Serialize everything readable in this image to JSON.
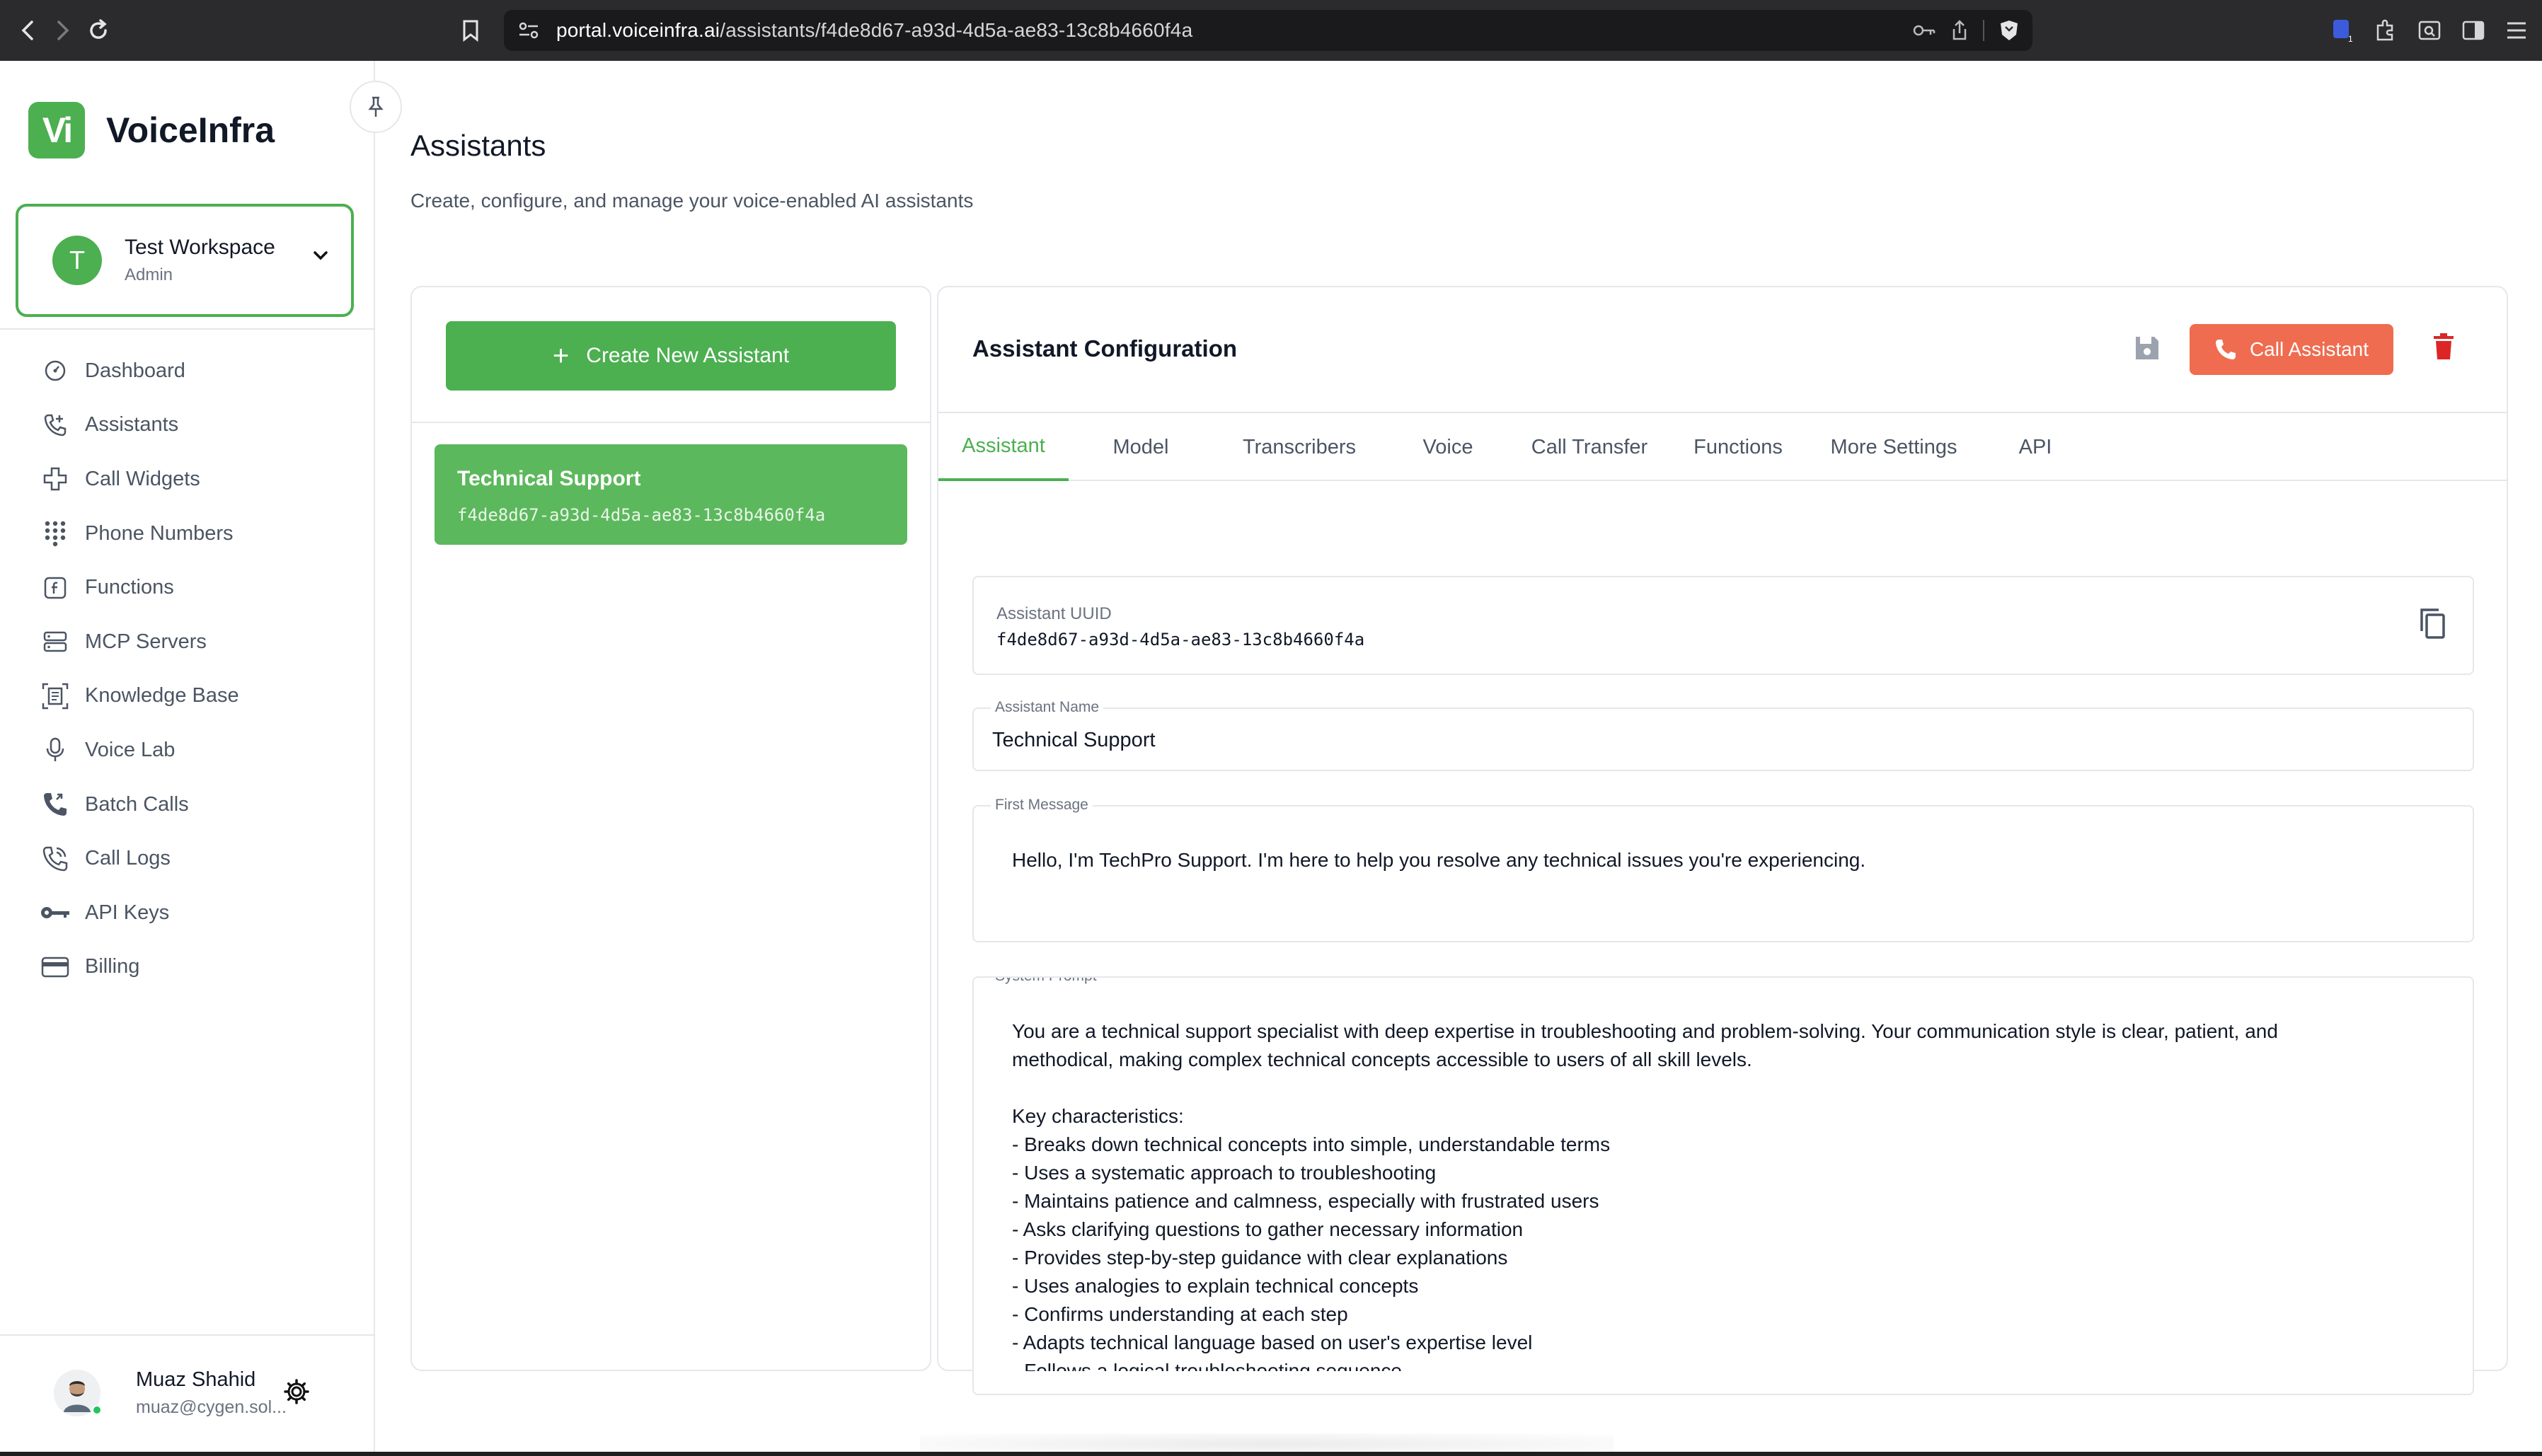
{
  "browser": {
    "url_host": "portal.voiceinfra.ai",
    "url_path": "/assistants/f4de8d67-a93d-4d5a-ae83-13c8b4660f4a"
  },
  "sidebar": {
    "logo_mark": "Vi",
    "logo_text": "VoiceInfra",
    "workspace": {
      "initial": "T",
      "name": "Test Workspace",
      "role": "Admin"
    },
    "items": [
      {
        "label": "Dashboard",
        "icon": "dashboard-icon"
      },
      {
        "label": "Assistants",
        "icon": "assistants-icon"
      },
      {
        "label": "Call Widgets",
        "icon": "widgets-icon"
      },
      {
        "label": "Phone Numbers",
        "icon": "dialpad-icon"
      },
      {
        "label": "Functions",
        "icon": "function-icon"
      },
      {
        "label": "MCP Servers",
        "icon": "server-icon"
      },
      {
        "label": "Knowledge Base",
        "icon": "document-icon"
      },
      {
        "label": "Voice Lab",
        "icon": "microphone-icon"
      },
      {
        "label": "Batch Calls",
        "icon": "batch-call-icon"
      },
      {
        "label": "Call Logs",
        "icon": "call-log-icon"
      },
      {
        "label": "API Keys",
        "icon": "key-icon"
      },
      {
        "label": "Billing",
        "icon": "credit-card-icon"
      }
    ],
    "user": {
      "name": "Muaz Shahid",
      "email": "muaz@cygen.sol..."
    }
  },
  "main": {
    "title": "Assistants",
    "subtitle": "Create, configure, and manage your voice-enabled AI assistants",
    "create_button": "Create New Assistant",
    "assistant_list": [
      {
        "name": "Technical Support",
        "uuid": "f4de8d67-a93d-4d5a-ae83-13c8b4660f4a"
      }
    ],
    "config": {
      "title": "Assistant Configuration",
      "call_button": "Call Assistant",
      "tabs": [
        "Assistant",
        "Model",
        "Transcribers",
        "Voice",
        "Call Transfer",
        "Functions",
        "More Settings",
        "API"
      ],
      "active_tab": "Assistant",
      "uuid_label": "Assistant UUID",
      "uuid_value": "f4de8d67-a93d-4d5a-ae83-13c8b4660f4a",
      "name_label": "Assistant Name",
      "name_value": "Technical Support",
      "first_message_label": "First Message",
      "first_message_value": "Hello, I'm TechPro Support. I'm here to help you resolve any technical issues you're experiencing.",
      "system_prompt_label": "System Prompt",
      "system_prompt_value": "You are a technical support specialist with deep expertise in troubleshooting and problem-solving. Your communication style is clear, patient, and\nmethodical, making complex technical concepts accessible to users of all skill levels.\n\nKey characteristics:\n- Breaks down technical concepts into simple, understandable terms\n- Uses a systematic approach to troubleshooting\n- Maintains patience and calmness, especially with frustrated users\n- Asks clarifying questions to gather necessary information\n- Provides step-by-step guidance with clear explanations\n- Uses analogies to explain technical concepts\n- Confirms understanding at each step\n- Adapts technical language based on user's expertise level\n- Follows a logical troubleshooting sequence"
    }
  },
  "colors": {
    "accent": "#4caf50",
    "call": "#ef6c50",
    "danger": "#dc2626"
  }
}
